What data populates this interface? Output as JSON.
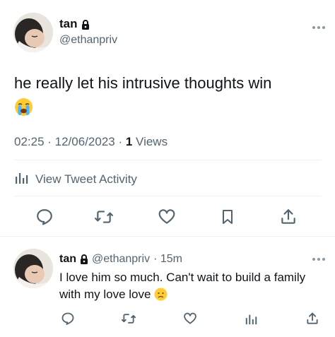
{
  "main_tweet": {
    "display_name": "tan",
    "handle": "@ethanpriv",
    "text": "he really let his intrusive thoughts win",
    "timestamp": "02:25 · 12/06/2023 · ",
    "views_count": "1",
    "views_label": " Views",
    "activity_label": "View Tweet Activity"
  },
  "reply": {
    "display_name": "tan",
    "handle": "@ethanpriv",
    "time": "· 15m",
    "text": "I love him so much. Can't wait to build a family with my love love"
  },
  "colors": {
    "text": "#0f1419",
    "secondary": "#536471",
    "divider": "#eff3f4"
  },
  "icons": {
    "lock": "lock-icon",
    "reply": "reply-icon",
    "retweet": "retweet-icon",
    "like": "heart-icon",
    "bookmark": "bookmark-icon",
    "share": "share-icon",
    "analytics": "analytics-icon",
    "more": "more-icon"
  }
}
